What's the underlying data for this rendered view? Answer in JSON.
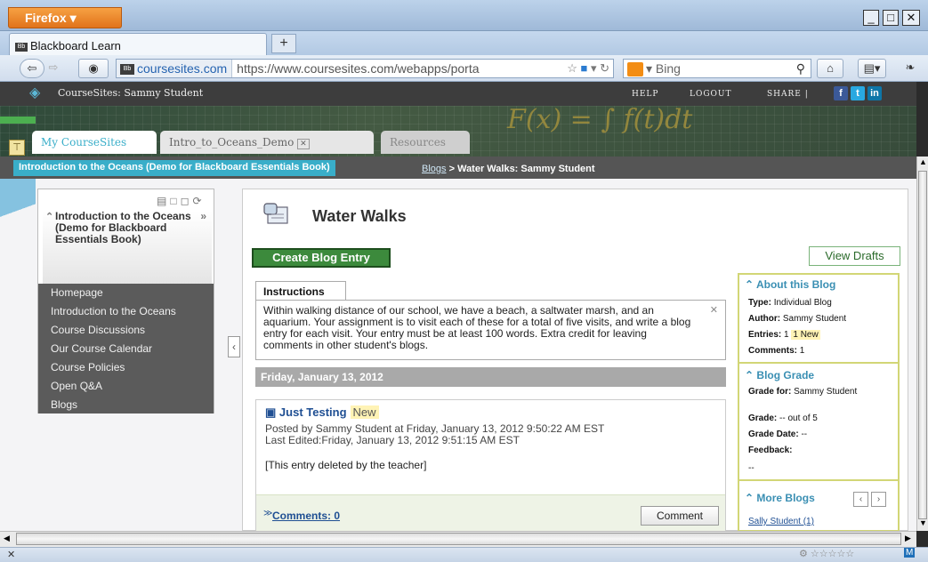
{
  "browser": {
    "app_button": "Firefox",
    "tab_title": "Blackboard Learn",
    "new_tab": "+",
    "url_site": "coursesites.com",
    "url_path": "https://www.coursesites.com/webapps/porta",
    "search_placeholder": "Bing",
    "favicon_text": "Bb"
  },
  "topbar": {
    "user": "CourseSites: Sammy Student",
    "help": "HELP",
    "logout": "LOGOUT",
    "share": "SHARE |"
  },
  "banner": {
    "formula": "F(x) = ∫ f(t)dt",
    "tabs": [
      "My CourseSites",
      "Intro_to_Oceans_Demo",
      "Resources"
    ]
  },
  "breadcrumb": {
    "course": "Introduction to the Oceans (Demo for Blackboard Essentials Book)",
    "link": "Blogs",
    "separator": ">",
    "current": "Water Walks: Sammy Student"
  },
  "menu": {
    "title": "Introduction to the Oceans (Demo for Blackboard Essentials Book)",
    "items": [
      "Homepage",
      "Introduction to the Oceans",
      "Course Discussions",
      "Our Course Calendar",
      "Course Policies",
      "Open Q&A",
      "Blogs"
    ]
  },
  "blog": {
    "title": "Water Walks",
    "create_button": "Create Blog Entry",
    "drafts_button": "View Drafts",
    "instructions_tab": "Instructions",
    "instructions_text": "Within walking distance of our school, we have a beach, a saltwater marsh, and an aquarium. Your assignment is to visit each of these for a total of five visits, and write a blog entry for each visit. Your entry must be at least 100 words. Extra credit for leaving comments in other student's blogs.",
    "date_header": "Friday, January 13, 2012",
    "entry": {
      "title": "Just Testing",
      "badge": "New",
      "posted": "Posted by Sammy Student at Friday, January 13, 2012 9:50:22 AM EST",
      "edited": "Last Edited:Friday, January 13, 2012 9:51:15 AM EST",
      "body": "[This entry deleted by the teacher]",
      "comments_link": "Comments: 0",
      "comment_button": "Comment"
    }
  },
  "about": {
    "heading": "About this Blog",
    "type_label": "Type:",
    "type_value": "Individual Blog",
    "author_label": "Author:",
    "author_value": "Sammy Student",
    "entries_label": "Entries:",
    "entries_value": "1",
    "entries_new": "1 New",
    "comments_label": "Comments:",
    "comments_value": "1"
  },
  "grade": {
    "heading": "Blog Grade",
    "for_label": "Grade for:",
    "for_value": "Sammy Student",
    "grade_label": "Grade:",
    "grade_value": "-- out of 5",
    "date_label": "Grade Date:",
    "date_value": "--",
    "feedback_label": "Feedback:",
    "feedback_value": "--"
  },
  "more": {
    "heading": "More Blogs",
    "first_item": "Sally Student (1)"
  },
  "colors": {
    "accent_teal": "#39aec9",
    "create_green": "#3c8a3c",
    "side_border": "#d2d676",
    "firefox_orange": "#e1731b"
  }
}
